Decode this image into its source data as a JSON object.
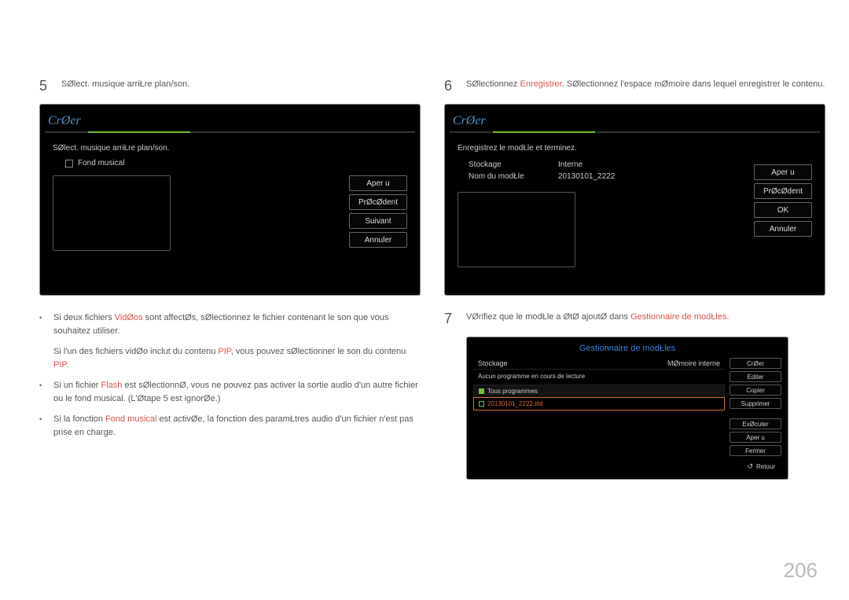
{
  "page_number": "206",
  "left": {
    "step_num": "5",
    "step_text": "SØlect. musique arriŁre plan/son.",
    "panel": {
      "title": "CrØer",
      "instruction": "SØlect. musique arriŁre plan/son.",
      "checkbox_label": "Fond musical",
      "buttons": [
        "Aper u",
        "PrØcØdent",
        "Suivant",
        "Annuler"
      ]
    },
    "notes": [
      {
        "pre": "Si deux fichiers ",
        "hl": "VidØos",
        "post": " sont affectØs, sØlectionnez le fichier contenant le son que vous souhaitez utiliser."
      },
      {
        "pre": "Si l'un des fichiers vidØo inclut du contenu ",
        "hl": "PIP",
        "post": ", vous pouvez sØlectionner le son du contenu ",
        "hl2": "PIP",
        "post2": "."
      },
      {
        "pre": "Si un fichier ",
        "hl": "Flash",
        "post": " est sØlectionnØ, vous ne pouvez pas activer la sortie audio d'un autre fichier ou le fond musical. (L'Øtape 5 est ignorØe.)"
      },
      {
        "pre": "Si la fonction ",
        "hl": "Fond musical",
        "post": " est activØe, la fonction des paramŁtres audio d'un fichier n'est pas prise en charge."
      }
    ]
  },
  "right": {
    "step6_num": "6",
    "step6_pre": "SØlectionnez ",
    "step6_hl": "Enregistrer",
    "step6_post": ". SØlectionnez l'espace mØmoire dans lequel enregistrer le contenu.",
    "panel": {
      "title": "CrØer",
      "instruction": "Enregistrez le modŁle et terminez.",
      "rows": [
        {
          "k": "Stockage",
          "v": "Interne"
        },
        {
          "k": "Nom du modŁle",
          "v": "20130101_2222"
        }
      ],
      "buttons": [
        "Aper u",
        "PrØcØdent",
        "OK",
        "Annuler"
      ]
    },
    "step7_num": "7",
    "step7_pre": "VØrifiez que le modŁle a ØtØ ajoutØ dans ",
    "step7_hl": "Gestionnaire de modŁles",
    "step7_post": ".",
    "mini": {
      "title": "Gestionnaire de modŁles",
      "top_left": "Stockage",
      "top_right": "MØmoire interne",
      "sub": "Aucun programme en cours de lecture",
      "list_head": "Tous programmes",
      "file": "20130101_2222.tltd",
      "buttons": [
        "CrØer",
        "Editer",
        "Copier",
        "Supprimer",
        "ExØcuter",
        "Aper u",
        "Fermer"
      ],
      "return": "Retour"
    }
  }
}
